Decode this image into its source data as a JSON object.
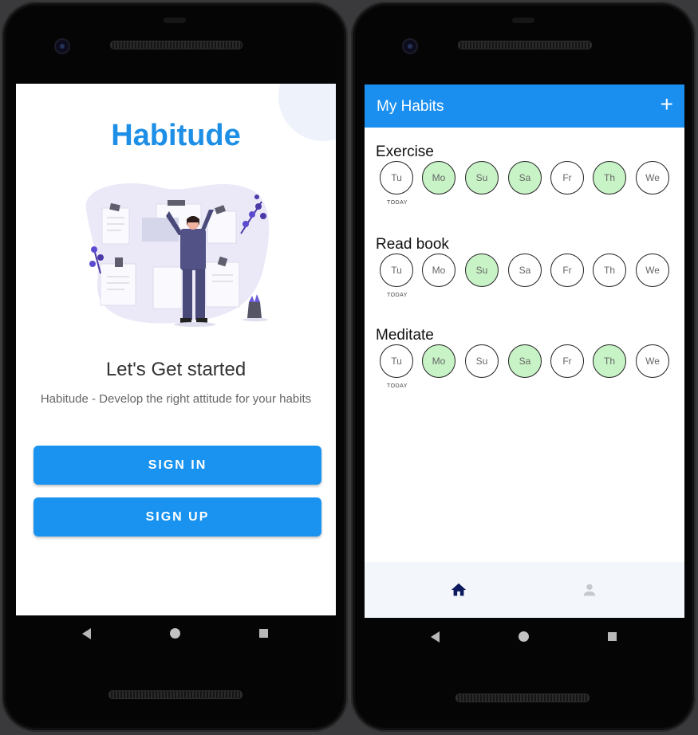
{
  "welcome": {
    "brand": "Habitude",
    "headline": "Let's Get started",
    "tagline": "Habitude - Develop the right attitude for your habits",
    "sign_in_label": "SIGN IN",
    "sign_up_label": "SIGN UP"
  },
  "habits_screen": {
    "title": "My Habits",
    "add_icon": "plus-icon",
    "today_label": "TODAY",
    "habits": [
      {
        "name": "Exercise",
        "days": [
          {
            "label": "Tu",
            "done": false
          },
          {
            "label": "Mo",
            "done": true
          },
          {
            "label": "Su",
            "done": true
          },
          {
            "label": "Sa",
            "done": true
          },
          {
            "label": "Fr",
            "done": false
          },
          {
            "label": "Th",
            "done": true
          },
          {
            "label": "We",
            "done": false
          }
        ]
      },
      {
        "name": "Read book",
        "days": [
          {
            "label": "Tu",
            "done": false
          },
          {
            "label": "Mo",
            "done": false
          },
          {
            "label": "Su",
            "done": true
          },
          {
            "label": "Sa",
            "done": false
          },
          {
            "label": "Fr",
            "done": false
          },
          {
            "label": "Th",
            "done": false
          },
          {
            "label": "We",
            "done": false
          }
        ]
      },
      {
        "name": "Meditate",
        "days": [
          {
            "label": "Tu",
            "done": false
          },
          {
            "label": "Mo",
            "done": true
          },
          {
            "label": "Su",
            "done": false
          },
          {
            "label": "Sa",
            "done": true
          },
          {
            "label": "Fr",
            "done": false
          },
          {
            "label": "Th",
            "done": true
          },
          {
            "label": "We",
            "done": false
          }
        ]
      }
    ],
    "nav": [
      {
        "icon": "home-icon",
        "active": true
      },
      {
        "icon": "person-icon",
        "active": false
      }
    ]
  },
  "colors": {
    "primary": "#1a8ff0",
    "done_fill": "#c8f3c6",
    "nav_active": "#0d1b5e",
    "nav_inactive": "#c6c9ce"
  },
  "system_nav": {
    "icons": [
      "back-icon",
      "home-circle-icon",
      "recents-icon"
    ]
  }
}
